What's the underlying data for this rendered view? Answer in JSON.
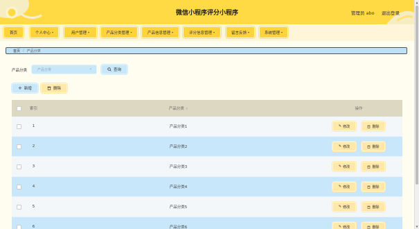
{
  "header": {
    "title": "微信小程序评分小程序",
    "admin_text": "管理员 abo",
    "logout_label": "退出登录"
  },
  "nav": {
    "items": [
      {
        "label": "首页",
        "has_caret": false
      },
      {
        "label": "个人中心",
        "has_caret": true
      },
      {
        "label": "用户管理",
        "has_caret": true
      },
      {
        "label": "产品分类管理",
        "has_caret": true
      },
      {
        "label": "产品信息管理",
        "has_caret": true
      },
      {
        "label": "评分信息管理",
        "has_caret": true
      },
      {
        "label": "留言反馈",
        "has_caret": true
      },
      {
        "label": "系统管理",
        "has_caret": true
      }
    ]
  },
  "breadcrumb": {
    "home": "首页",
    "separator": "/",
    "current": "产品分类"
  },
  "search": {
    "label": "产品分类",
    "placeholder": "产品分类",
    "search_label": "查询",
    "add_label": "新增",
    "delete_label": "删除"
  },
  "table": {
    "headers": {
      "index": "索引",
      "name": "产品分类",
      "ops": "操作"
    },
    "edit_label": "修改",
    "delete_label": "删除",
    "rows": [
      {
        "index": "1",
        "name": "产品分类1"
      },
      {
        "index": "2",
        "name": "产品分类2"
      },
      {
        "index": "3",
        "name": "产品分类3"
      },
      {
        "index": "4",
        "name": "产品分类4"
      },
      {
        "index": "5",
        "name": "产品分类5"
      },
      {
        "index": "6",
        "name": "产品分类6"
      }
    ]
  },
  "colors": {
    "header_bg": "#ffda44",
    "nav_button": "#ffd43b",
    "row_alt": "#c8e7fb",
    "table_header": "#dcd8c2",
    "button_blue": "#c8e7f9",
    "button_yellow": "#ffe8a8"
  }
}
